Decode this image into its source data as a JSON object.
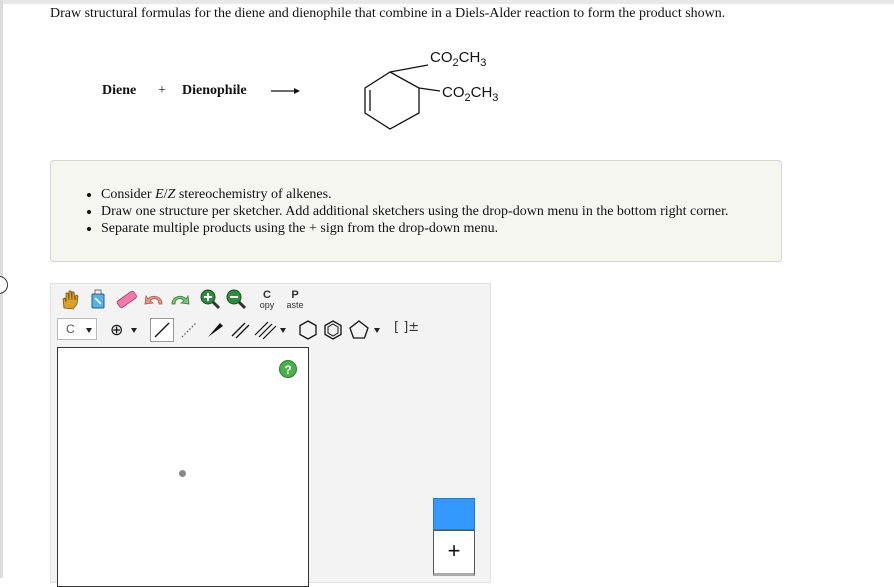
{
  "question": {
    "text": "Draw structural formulas for the diene and dienophile that combine in a Diels-Alder reaction to form the product shown."
  },
  "reaction": {
    "reactant1": "Diene",
    "plus": "+",
    "reactant2": "Dienophile",
    "product_substituent_top": [
      "CO",
      "2",
      "CH",
      "3"
    ],
    "product_substituent_right": [
      "CO",
      "2",
      "CH",
      "3"
    ]
  },
  "hints": {
    "items": [
      {
        "pre": "Consider ",
        "em1": "E",
        "slash": "/",
        "em2": "Z",
        "post": " stereochemistry of alkenes."
      },
      {
        "text": "Draw one structure per sketcher. Add additional sketchers using the drop-down menu in the bottom right corner."
      },
      {
        "text": "Separate multiple products using the + sign from the drop-down menu."
      }
    ]
  },
  "toolbar": {
    "copy_top": "C",
    "copy_bottom": "opy",
    "paste_top": "P",
    "paste_bottom": "aste",
    "element_value": "C",
    "charge_label": "⊕",
    "bracket_label": "[ ]±"
  },
  "canvas": {
    "help_label": "?"
  },
  "sketch_menu": {
    "add_label": "+"
  },
  "colors": {
    "info_bg": "#f6f6f1",
    "help_green": "#4cae4c",
    "menu_blue": "#3399ff"
  }
}
